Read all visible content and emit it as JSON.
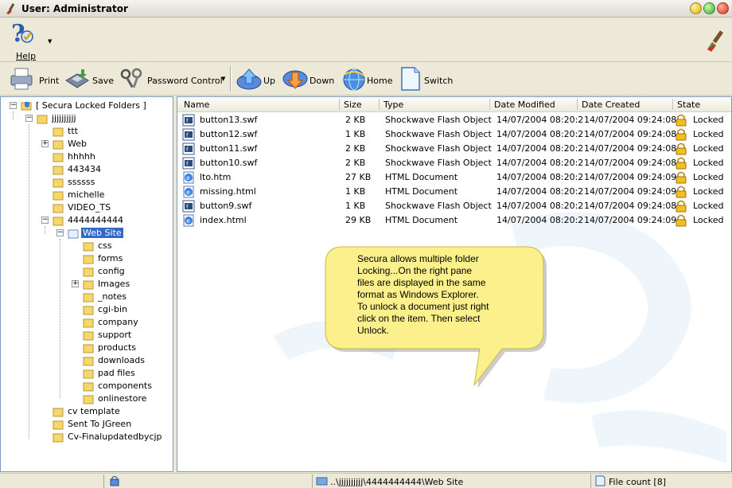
{
  "window": {
    "title": "User: Administrator"
  },
  "helpbar": {
    "help_label": "Help"
  },
  "toolbar": {
    "print": "Print",
    "save": "Save",
    "password_control": "Password Control",
    "up": "Up",
    "down": "Down",
    "home": "Home",
    "switch": "Switch"
  },
  "tree": {
    "root": "[ Secura Locked Folders ]",
    "top": "jjjjjjjjjj",
    "items": [
      "ttt",
      "Web",
      "hhhhh",
      "443434",
      "ssssss",
      "michelle",
      "VIDEO_TS",
      "4444444444"
    ],
    "selected": "Web Site",
    "subitems": [
      "css",
      "forms",
      "config",
      "Images",
      "_notes",
      "cgi-bin",
      "company",
      "support",
      "products",
      "downloads",
      "pad files",
      "components",
      "onlinestore"
    ],
    "bottom_items": [
      "cv template",
      "Sent To JGreen",
      "Cv-Finalupdatedbycjp"
    ]
  },
  "list": {
    "columns": [
      "Name",
      "Size",
      "Type",
      "Date Modified",
      "Date Created",
      "State"
    ],
    "rows": [
      {
        "name": "button13.swf",
        "size": "2 KB",
        "type": "Shockwave Flash Object",
        "modified": "14/07/2004 08:20:2",
        "created": "14/07/2004 09:24:08",
        "state": "Locked",
        "icon": "flash-file-icon"
      },
      {
        "name": "button12.swf",
        "size": "1 KB",
        "type": "Shockwave Flash Object",
        "modified": "14/07/2004 08:20:2",
        "created": "14/07/2004 09:24:08",
        "state": "Locked",
        "icon": "flash-file-icon"
      },
      {
        "name": "button11.swf",
        "size": "2 KB",
        "type": "Shockwave Flash Object",
        "modified": "14/07/2004 08:20:2",
        "created": "14/07/2004 09:24:08",
        "state": "Locked",
        "icon": "flash-file-icon"
      },
      {
        "name": "button10.swf",
        "size": "2 KB",
        "type": "Shockwave Flash Object",
        "modified": "14/07/2004 08:20:2",
        "created": "14/07/2004 09:24:08",
        "state": "Locked",
        "icon": "flash-file-icon"
      },
      {
        "name": "lto.htm",
        "size": "27 KB",
        "type": "HTML Document",
        "modified": "14/07/2004 08:20:2",
        "created": "14/07/2004 09:24:09",
        "state": "Locked",
        "icon": "html-file-icon"
      },
      {
        "name": "missing.html",
        "size": "1 KB",
        "type": "HTML Document",
        "modified": "14/07/2004 08:20:2",
        "created": "14/07/2004 09:24:09",
        "state": "Locked",
        "icon": "html-file-icon"
      },
      {
        "name": "button9.swf",
        "size": "1 KB",
        "type": "Shockwave Flash Object",
        "modified": "14/07/2004 08:20:2",
        "created": "14/07/2004 09:24:08",
        "state": "Locked",
        "icon": "flash-file-icon"
      },
      {
        "name": "index.html",
        "size": "29 KB",
        "type": "HTML Document",
        "modified": "14/07/2004 08:20:2",
        "created": "14/07/2004 09:24:09",
        "state": "Locked",
        "icon": "html-file-icon"
      }
    ]
  },
  "callout": {
    "lines": [
      "Secura allows multiple folder",
      "Locking...On the right pane",
      "files are displayed in the same",
      "format as Windows Explorer.",
      "To unlock a document just right",
      "click on the item. Then select",
      "Unlock."
    ]
  },
  "status": {
    "path": "..\\jjjjjjjjjj\\4444444444\\Web Site",
    "file_count": "File count [8]"
  },
  "colors": {
    "selection": "#316ac5",
    "folder": "#f5d76e",
    "callout": "#fbf08c",
    "chrome": "#ece9d8"
  }
}
